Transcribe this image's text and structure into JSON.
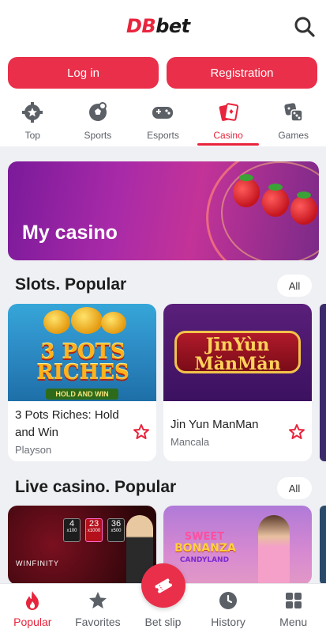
{
  "header": {
    "logo_part1": "DB",
    "logo_part2": "bet",
    "search_icon": "search-icon"
  },
  "auth": {
    "login_label": "Log in",
    "register_label": "Registration",
    "accent": "#ea2f4a"
  },
  "tabs": [
    {
      "label": "Top",
      "icon": "gear-star-icon",
      "active": false
    },
    {
      "label": "Sports",
      "icon": "soccer-ball-icon",
      "active": false
    },
    {
      "label": "Esports",
      "icon": "gamepad-icon",
      "active": false
    },
    {
      "label": "Casino",
      "icon": "playing-cards-icon",
      "active": true
    },
    {
      "label": "Games",
      "icon": "dice-icon",
      "active": false
    }
  ],
  "banner": {
    "title": "My casino"
  },
  "slots_section": {
    "title": "Slots. Popular",
    "all_label": "All",
    "cards": [
      {
        "art_line1": "3 POTS",
        "art_line2": "RICHES",
        "art_tag": "HOLD AND WIN",
        "name": "3 Pots Riches: Hold and Win",
        "provider": "Playson"
      },
      {
        "art_line1": "JīnYùn",
        "art_line2": "MănMăn",
        "name": "Jin Yun ManMan",
        "provider": "Mancala"
      }
    ]
  },
  "live_section": {
    "title": "Live casino. Popular",
    "all_label": "All",
    "cards": [
      {
        "art_brand": "WINFINITY",
        "art_chips": [
          "4",
          "23",
          "36"
        ],
        "art_multipliers": [
          "x100",
          "x1000",
          "x500"
        ]
      },
      {
        "art_line1": "SWEET",
        "art_line2": "BONANZA",
        "art_line3": "CANDYLAND"
      }
    ]
  },
  "bottom_nav": [
    {
      "label": "Popular",
      "icon": "flame-icon",
      "active": true
    },
    {
      "label": "Favorites",
      "icon": "star-icon",
      "active": false
    },
    {
      "label": "Bet slip",
      "icon": "ticket-icon",
      "active": false
    },
    {
      "label": "History",
      "icon": "clock-icon",
      "active": false
    },
    {
      "label": "Menu",
      "icon": "grid-menu-icon",
      "active": false
    }
  ]
}
